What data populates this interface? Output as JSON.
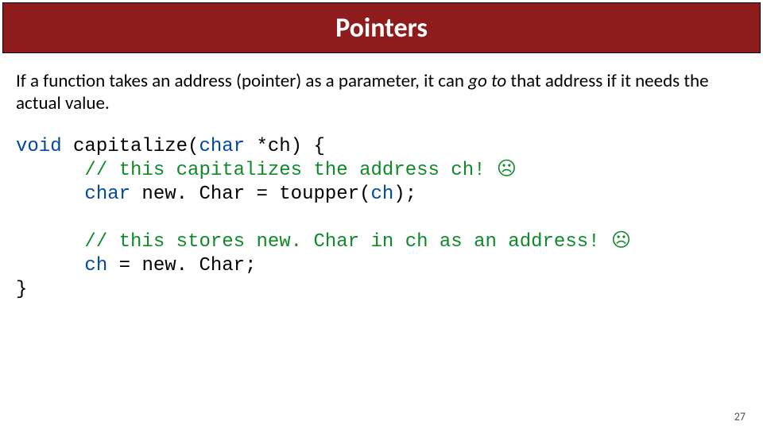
{
  "slide": {
    "title": "Pointers",
    "paragraph": {
      "pre": "If a function takes an address (pointer) as a parameter, it can ",
      "emph": "go to",
      "post": " that address if it needs the actual value."
    },
    "code": {
      "l1a": "void",
      "l1b": " capitalize(",
      "l1c": "char",
      "l1d": " *ch) {",
      "l2a": "// this capitalizes the address ch! ",
      "l2b": "☹",
      "l3a": "char",
      "l3b": " new. Char = toupper(",
      "l3c": "ch",
      "l3d": ");",
      "l4a": "// this stores new. Char in ch as an address! ",
      "l4b": "☹",
      "l5a": "ch",
      "l5b": " = new. Char;",
      "l6": "}"
    },
    "page_number": "27"
  }
}
